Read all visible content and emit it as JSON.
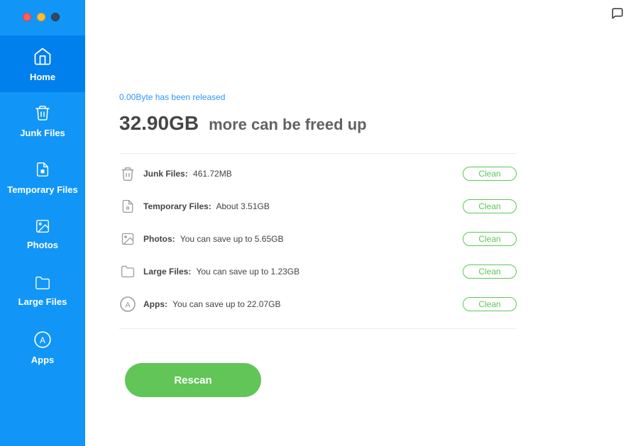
{
  "sidebar": {
    "items": [
      {
        "id": "home",
        "label": "Home",
        "active": true
      },
      {
        "id": "junk-files",
        "label": "Junk Files",
        "active": false
      },
      {
        "id": "temporary-files",
        "label": "Temporary Files",
        "active": false
      },
      {
        "id": "photos",
        "label": "Photos",
        "active": false
      },
      {
        "id": "large-files",
        "label": "Large Files",
        "active": false
      },
      {
        "id": "apps",
        "label": "Apps",
        "active": false
      }
    ]
  },
  "main": {
    "released": {
      "amount": "0.00Byte",
      "text": "has been released"
    },
    "headline": {
      "amount": "32.90GB",
      "text": "more can be freed up"
    },
    "clean_label": "Clean",
    "rescan_label": "Rescan",
    "rows": [
      {
        "id": "junk-files",
        "label": "Junk Files:",
        "value": "461.72MB"
      },
      {
        "id": "temporary-files",
        "label": "Temporary Files:",
        "value": "About 3.51GB"
      },
      {
        "id": "photos",
        "label": "Photos:",
        "value": "You can save up to 5.65GB"
      },
      {
        "id": "large-files",
        "label": "Large Files:",
        "value": "You can save up to 1.23GB"
      },
      {
        "id": "apps",
        "label": "Apps:",
        "value": "You can save up to 22.07GB"
      }
    ]
  },
  "colors": {
    "primary": "#1196f8",
    "primary_active": "#0080ed",
    "accent_green": "#61c558"
  }
}
